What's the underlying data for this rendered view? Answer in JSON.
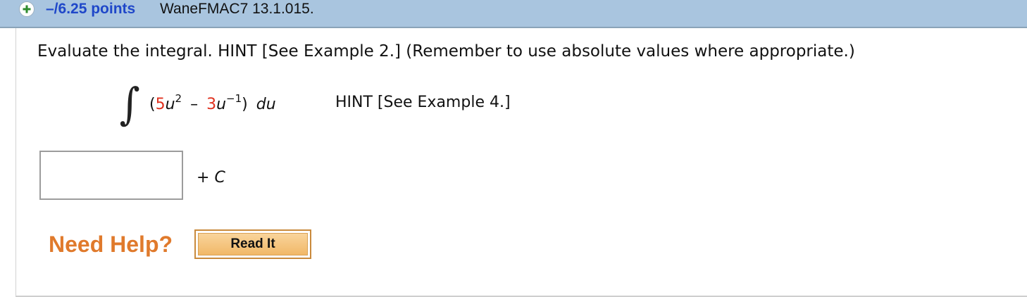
{
  "header": {
    "expand_icon": "plus-circle-icon",
    "points": "–/6.25 points",
    "problem_id": "WaneFMAC7 13.1.015."
  },
  "question": {
    "text": "Evaluate the integral. HINT [See Example 2.] (Remember to use absolute values where appropriate.)",
    "integral_symbol": "∫",
    "expression": {
      "open_paren": "(",
      "coef1": "5",
      "var1": "u",
      "exp1": "2",
      "minus": "–",
      "coef2": "3",
      "var2": "u",
      "exp2": "−1",
      "close_paren": ")",
      "differential": "du"
    },
    "hint": "HINT [See Example 4.]"
  },
  "answer": {
    "value": "",
    "placeholder": "",
    "plus": "+",
    "constant": "C"
  },
  "help": {
    "label": "Need Help?",
    "read_it": "Read It"
  },
  "colors": {
    "header_bg": "#a9c5df",
    "points": "#1f47c9",
    "coefficient_red": "#e0311f",
    "need_help_orange": "#e07a2c",
    "button_orange": "#f1b868"
  }
}
